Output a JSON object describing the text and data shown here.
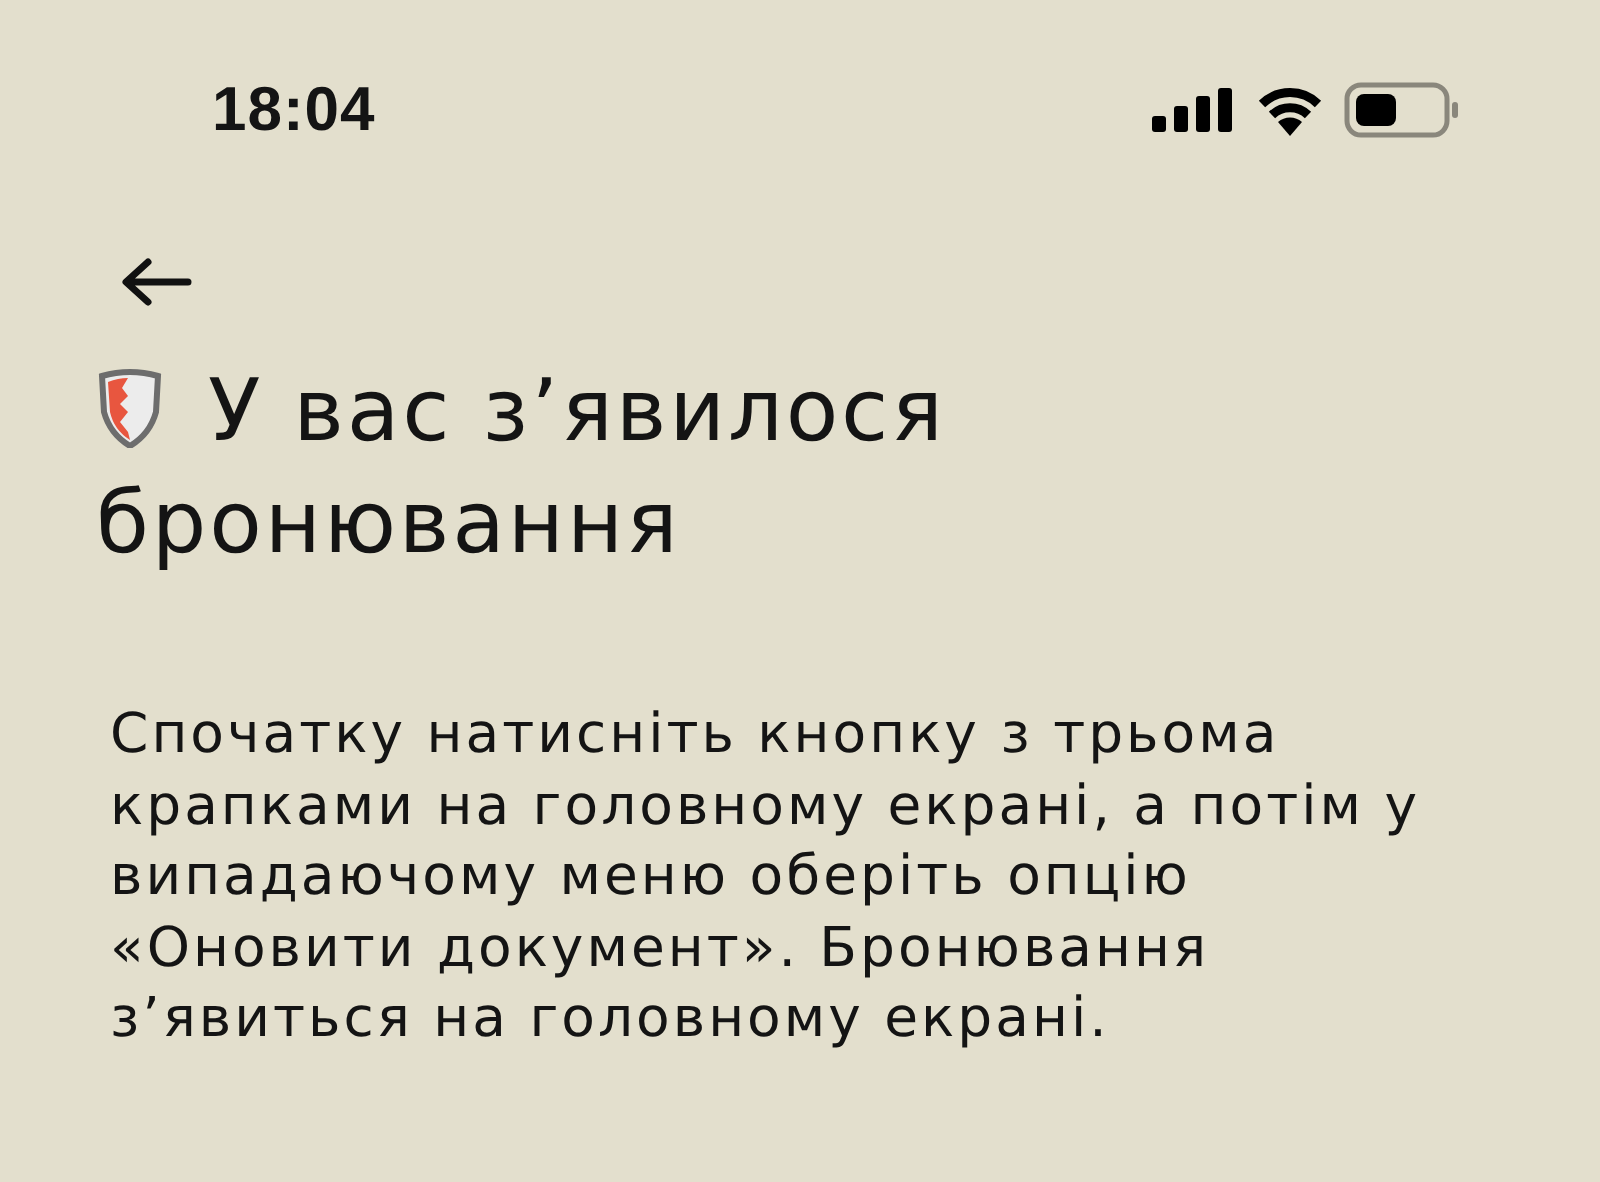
{
  "status_bar": {
    "time": "18:04"
  },
  "title_lines": [
    "У вас з’явилося",
    "бронювання"
  ],
  "body": "Спочатку натисніть кнопку з трьома крапками на головному екрані, а потім у випадаючому меню оберіть опцію «Оновити документ». Бронювання з’явиться на головному екрані."
}
